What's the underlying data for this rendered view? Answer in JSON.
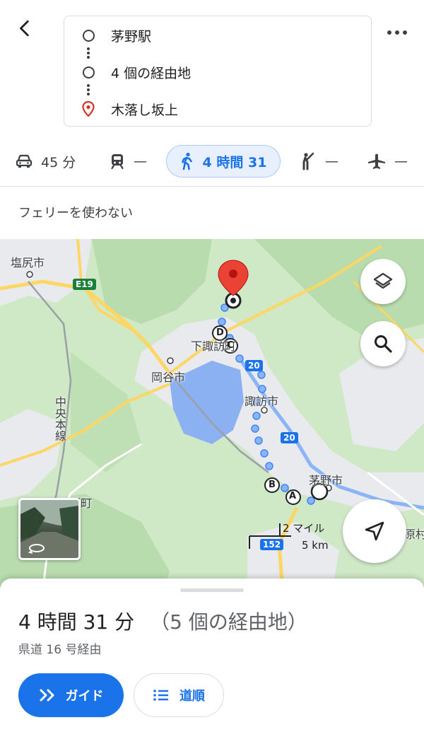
{
  "header": {
    "origin": "茅野駅",
    "waypoints": "4 個の経由地",
    "destination": "木落し坂上"
  },
  "modes": {
    "drive": "45 分",
    "transit": "—",
    "walk": "4 時間 31",
    "rideshare": "—",
    "flight": "—"
  },
  "options": {
    "text": "フェリーを使わない"
  },
  "map": {
    "labels": {
      "shiojiri": "塩尻市",
      "okaya": "岡谷市",
      "shimosuwa": "下諏訪町",
      "suwa": "諏訪市",
      "chino": "茅野市",
      "chuo_line": "中央本線",
      "tatsuno": "辰野町",
      "hara": "原村"
    },
    "shields": {
      "e19": "E19",
      "r20a": "20",
      "r20b": "20",
      "r152": "152"
    },
    "waypoint_letters": [
      "A",
      "B",
      "C",
      "D"
    ],
    "scale": {
      "miles": "2 マイル",
      "km": "5 km"
    }
  },
  "sheet": {
    "duration": "4 時間 31 分",
    "waypoints": "（5 個の経由地）",
    "via": "県道 16 号経由",
    "guide_label": "ガイド",
    "steps_label": "道順"
  },
  "colors": {
    "accent": "#1a73e8",
    "route": "#8ab4f8",
    "pin": "#ea4335",
    "map_green": "#cce8c4",
    "lake": "#8cb1f2"
  }
}
